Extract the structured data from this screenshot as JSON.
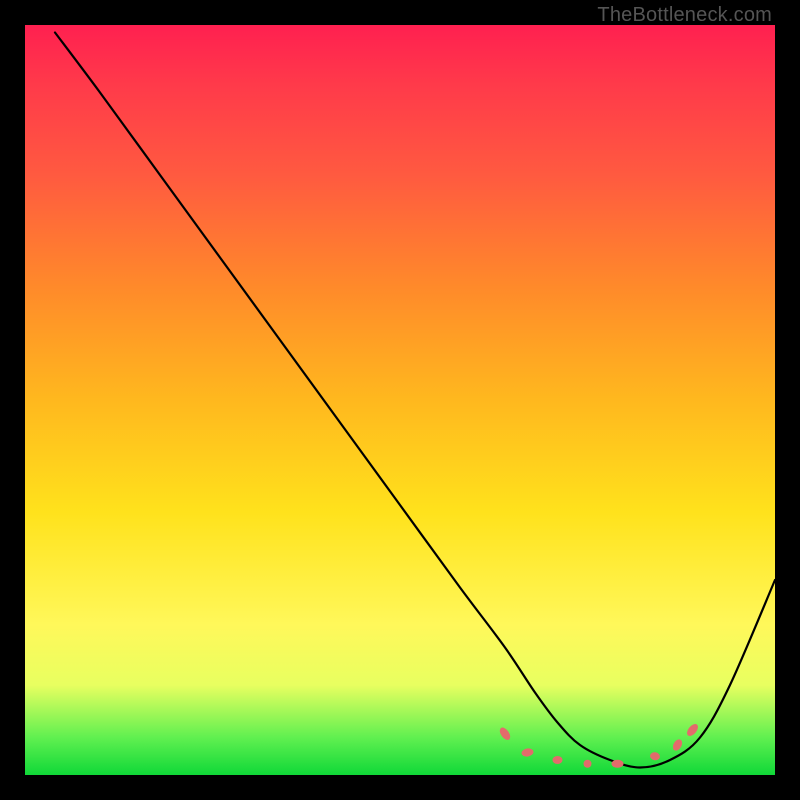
{
  "attribution": "TheBottleneck.com",
  "chart_data": {
    "type": "line",
    "title": "",
    "xlabel": "",
    "ylabel": "",
    "xlim": [
      0,
      100
    ],
    "ylim": [
      0,
      100
    ],
    "background_gradient": {
      "top": "#ff2050",
      "mid": "#ffe21c",
      "bottom": "#10d838"
    },
    "series": [
      {
        "name": "bottleneck-curve",
        "x": [
          4,
          10,
          18,
          26,
          34,
          42,
          50,
          58,
          64,
          68,
          71,
          74,
          78,
          82,
          86,
          90,
          94,
          100
        ],
        "y": [
          99,
          91,
          80,
          69,
          58,
          47,
          36,
          25,
          17,
          11,
          7,
          4,
          2,
          1,
          2,
          5,
          12,
          26
        ]
      }
    ],
    "markers": {
      "name": "optimal-range-dots",
      "color": "#e36b6b",
      "points": [
        {
          "x": 64,
          "y": 5.5,
          "rx": 4,
          "ry": 7,
          "rot": -35
        },
        {
          "x": 67,
          "y": 3.0,
          "rx": 6,
          "ry": 4,
          "rot": -10
        },
        {
          "x": 71,
          "y": 2.0,
          "rx": 5,
          "ry": 4,
          "rot": 0
        },
        {
          "x": 75,
          "y": 1.5,
          "rx": 4,
          "ry": 4,
          "rot": 0
        },
        {
          "x": 79,
          "y": 1.5,
          "rx": 6,
          "ry": 4,
          "rot": 0
        },
        {
          "x": 84,
          "y": 2.5,
          "rx": 5,
          "ry": 4,
          "rot": 10
        },
        {
          "x": 87,
          "y": 4.0,
          "rx": 4,
          "ry": 6,
          "rot": 30
        },
        {
          "x": 89,
          "y": 6.0,
          "rx": 4,
          "ry": 7,
          "rot": 40
        }
      ]
    }
  }
}
